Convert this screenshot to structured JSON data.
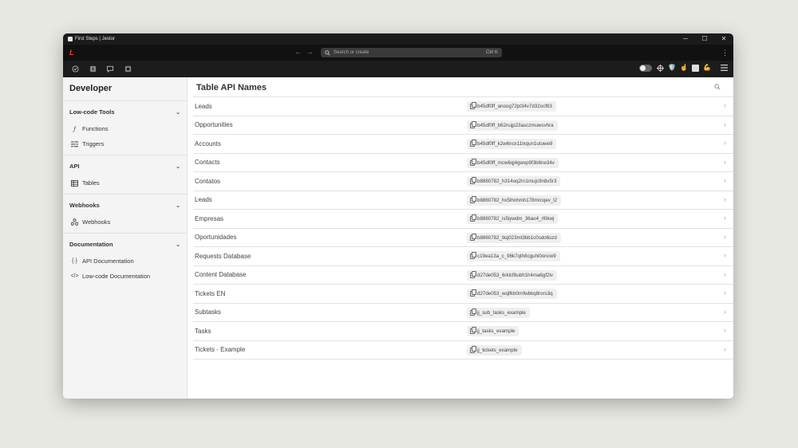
{
  "window": {
    "title": "First Steps | Jestor",
    "controls": {
      "minimize": "─",
      "maximize": "☐",
      "close": "✕"
    }
  },
  "topbar": {
    "logo": "L",
    "back": "←",
    "forward": "→",
    "search_placeholder": "Search or create",
    "search_shortcut": "Ctrl K",
    "menu": "⋮"
  },
  "toolbar": {
    "left_icons": [
      "check-circle-icon",
      "badge-icon",
      "chat-icon",
      "grid-icon"
    ],
    "right_icons": [
      "toggle-icon",
      "target-icon",
      "shield-emoji",
      "hand-emoji",
      "square-icon",
      "muscle-emoji",
      "list-icon"
    ]
  },
  "sidebar": {
    "title": "Developer",
    "sections": [
      {
        "label": "Low-code Tools",
        "items": [
          {
            "label": "Functions",
            "icon": "function-icon"
          },
          {
            "label": "Triggers",
            "icon": "triggers-icon"
          }
        ]
      },
      {
        "label": "API",
        "items": [
          {
            "label": "Tables",
            "icon": "table-icon"
          }
        ]
      },
      {
        "label": "Webhooks",
        "items": [
          {
            "label": "Webhooks",
            "icon": "webhook-icon"
          }
        ]
      },
      {
        "label": "Documentation",
        "items": [
          {
            "label": "API Documentation",
            "icon": "code-brackets-icon"
          },
          {
            "label": "Low-code Documentation",
            "icon": "code-slash-icon"
          }
        ]
      }
    ]
  },
  "main": {
    "title": "Table API Names",
    "rows": [
      {
        "name": "Leads",
        "api": "b45df0ff_anoog72pt34v7d32ocf83"
      },
      {
        "name": "Opportunities",
        "api": "b45df0ff_b62nujp23asczmuwsvhra"
      },
      {
        "name": "Accounts",
        "api": "b45df0ff_k2w6ncx11lxqun1utuwe9"
      },
      {
        "name": "Contacts",
        "api": "b45df0ff_mcw6qj4gwxp9f3b6ne34v"
      },
      {
        "name": "Contatos",
        "api": "b8860782_h314oq2rn1mujc9n8x5r3"
      },
      {
        "name": "Leads",
        "api": "b8860782_hx5lhnhmh178mrcqev_l2"
      },
      {
        "name": "Empresas",
        "api": "b8860782_is5iywdm_36ao4_rl0kwj"
      },
      {
        "name": "Oportunidades",
        "api": "b8860782_tkq023mt3bb1c0sdo6szd"
      },
      {
        "name": "Requests Database",
        "api": "c19ea13a_c_96k7qth8cguhi0oncw9"
      },
      {
        "name": "Content Database",
        "api": "d27de053_6rklcf8ubh1h4ma6gf2lv"
      },
      {
        "name": "Tickets EN",
        "api": "d27de053_wqlfkb0rnfwbkq8rors3q"
      },
      {
        "name": "Subtasks",
        "api": "jj_sub_tasks_example"
      },
      {
        "name": "Tasks",
        "api": "jj_tasks_example"
      },
      {
        "name": "Tickets - Example",
        "api": "jj_tickets_example"
      }
    ]
  }
}
